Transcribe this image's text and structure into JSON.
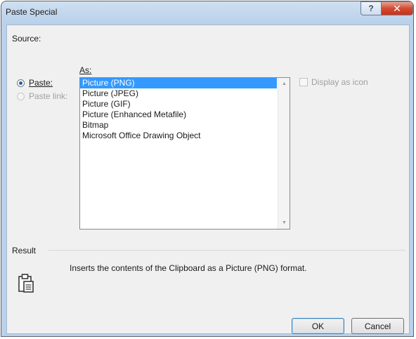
{
  "window": {
    "title": "Paste Special",
    "help_label": "?",
    "close_label": "✕"
  },
  "source": {
    "label": "Source:"
  },
  "options": {
    "paste_label": "Paste:",
    "paste_selected": true,
    "paste_link_label": "Paste link:",
    "paste_link_enabled": false
  },
  "as_label": "As:",
  "formats": [
    {
      "label": "Picture (PNG)",
      "selected": true
    },
    {
      "label": "Picture (JPEG)",
      "selected": false
    },
    {
      "label": "Picture (GIF)",
      "selected": false
    },
    {
      "label": "Picture (Enhanced Metafile)",
      "selected": false
    },
    {
      "label": "Bitmap",
      "selected": false
    },
    {
      "label": "Microsoft Office Drawing Object",
      "selected": false
    }
  ],
  "display_as_icon": {
    "label": "Display as icon",
    "checked": false,
    "enabled": false
  },
  "result": {
    "label": "Result",
    "description": "Inserts the contents of the Clipboard as a Picture (PNG) format.",
    "icon": "clipboard-paste-icon"
  },
  "buttons": {
    "ok": "OK",
    "cancel": "Cancel"
  },
  "colors": {
    "selection": "#3399ff",
    "title_bar": "#b9d1ea",
    "close_button": "#d24b32"
  }
}
